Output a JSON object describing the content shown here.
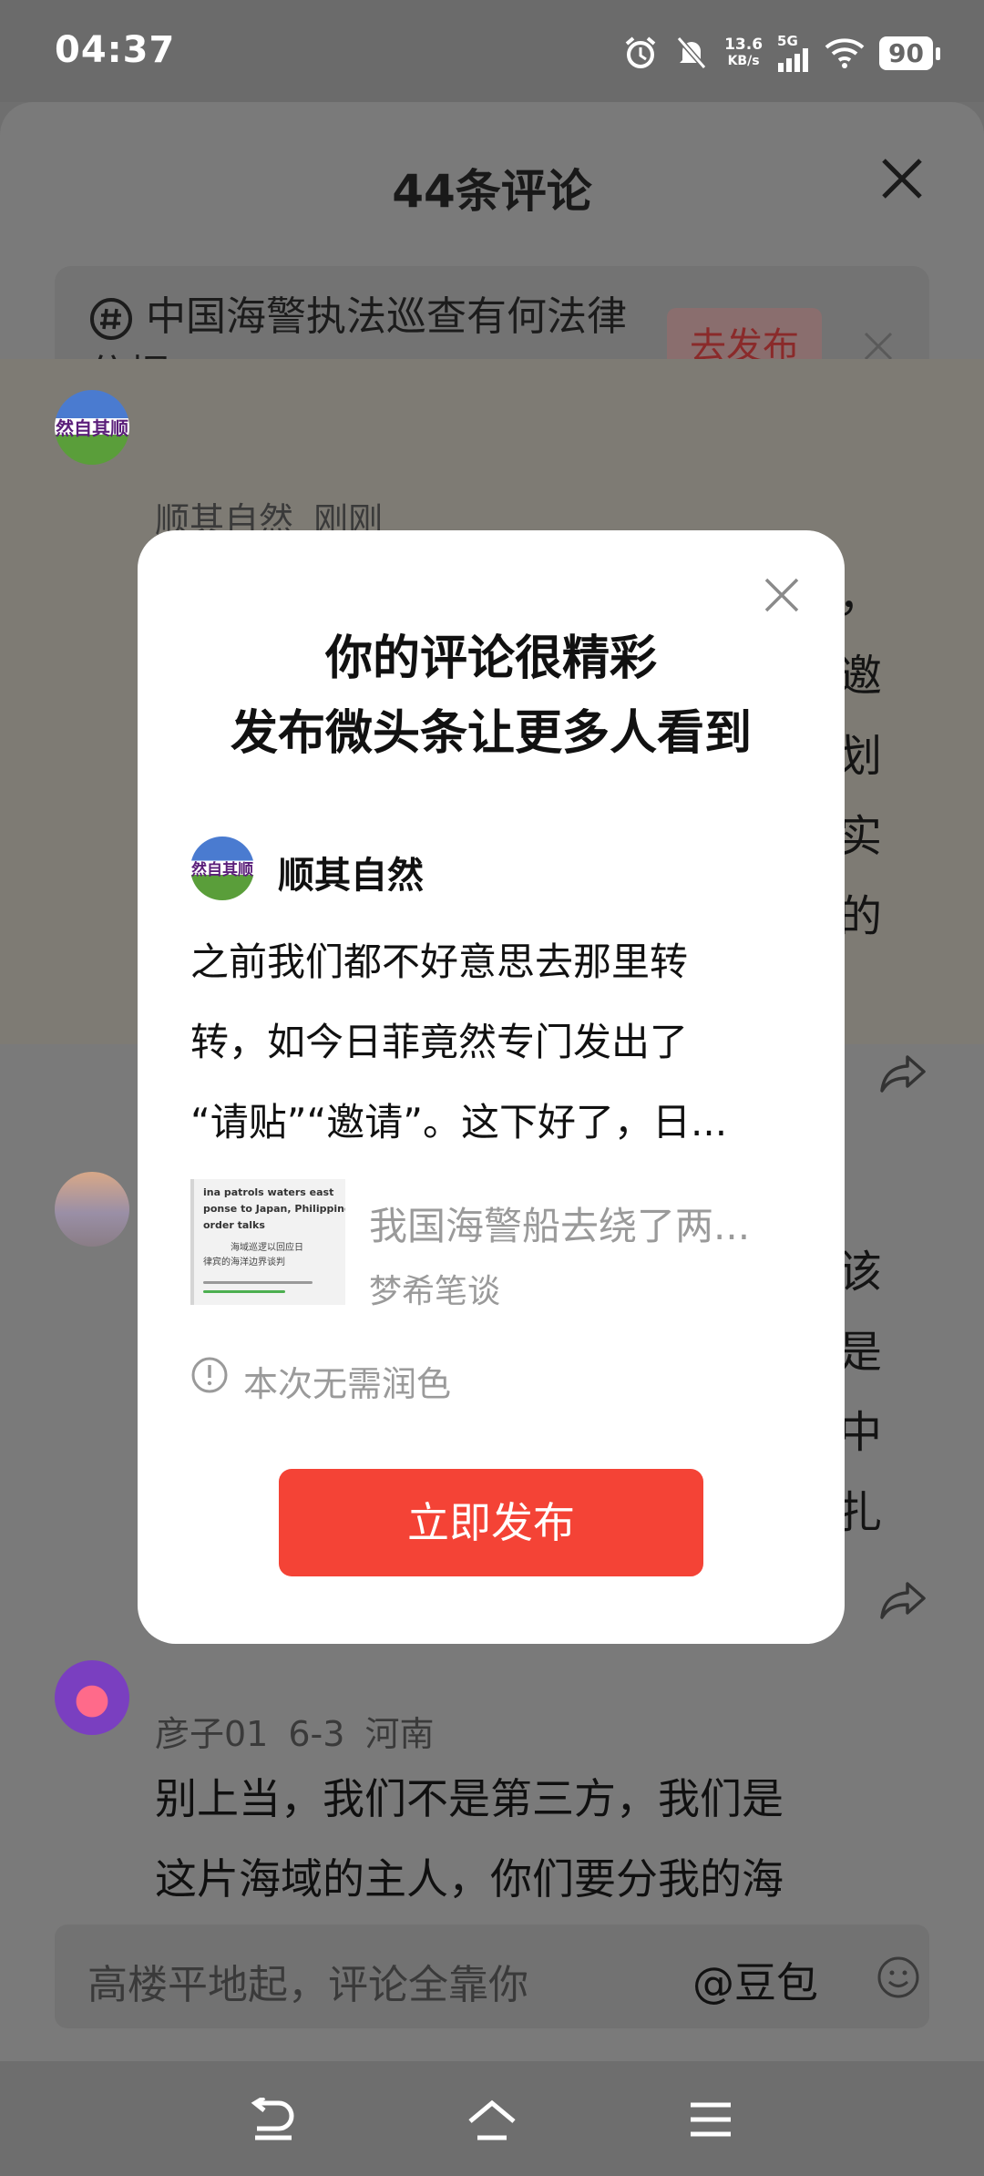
{
  "status_bar": {
    "time": "04:37",
    "net_speed_value": "13.6",
    "net_speed_unit": "KB/s",
    "network": "5G",
    "battery": "90"
  },
  "sheet": {
    "title": "44条评论",
    "topic": {
      "text": "中国海警执法巡查有何法律依据",
      "button": "去发布"
    }
  },
  "comments": [
    {
      "user": "顺其自然",
      "time": "刚刚",
      "avatar_text": "然自其顺",
      "edge_chars": [
        "，",
        "邀",
        "划",
        "实",
        "的"
      ]
    },
    {
      "edge_chars": [
        "该",
        "是中",
        "扎"
      ]
    },
    {
      "user": "彦子01",
      "time": "6-3",
      "location": "河南",
      "lines": [
        "别上当，我们不是第三方，我们是",
        "这片海域的主人，你们要分我的海"
      ]
    }
  ],
  "input": {
    "placeholder": "高楼平地起，评论全靠你",
    "mention": "@豆包"
  },
  "dialog": {
    "title_line1": "你的评论很精彩",
    "title_line2": "发布微头条让更多人看到",
    "author": "顺其自然",
    "avatar_text": "然自其顺",
    "body_line1": "之前我们都不好意思去那里转",
    "body_line2": "转，如今日菲竟然专门发出了",
    "body_line3": "“请贴”“邀请”。这下好了，日...",
    "quote": {
      "title": "我国海警船去绕了两...",
      "source": "梦希笔谈",
      "thumb_lines": [
        "ina patrols waters east",
        "ponse to Japan, Philippine mar",
        "order talks",
        "海域巡逻以回应日",
        "律宾的海洋边界谈判"
      ]
    },
    "note": "本次无需润色",
    "publish_button": "立即发布"
  },
  "colors": {
    "accent": "#f44336",
    "overlay": "#6f6f6f",
    "dialog_bg": "#ffffff"
  }
}
